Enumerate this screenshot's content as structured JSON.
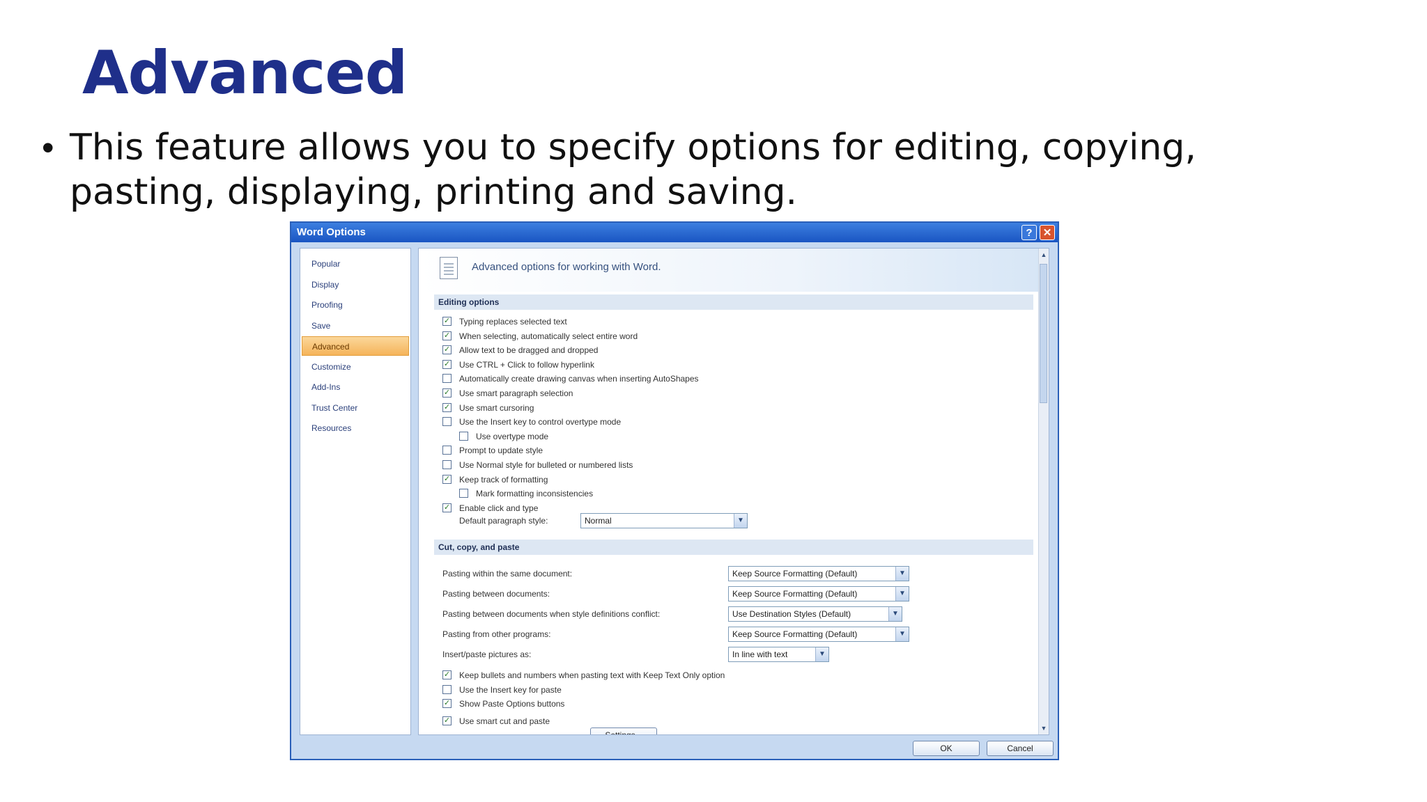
{
  "slide": {
    "title": "Advanced",
    "bullet": "This feature allows you to specify options for editing, copying, pasting, displaying, printing and saving."
  },
  "dialog": {
    "title": "Word Options",
    "help_glyph": "?",
    "close_glyph": "✕",
    "nav": [
      "Popular",
      "Display",
      "Proofing",
      "Save",
      "Advanced",
      "Customize",
      "Add-Ins",
      "Trust Center",
      "Resources"
    ],
    "selected_nav": "Advanced",
    "header_text": "Advanced options for working with Word.",
    "editing_section": "Editing options",
    "editing_options": [
      {
        "label": "Typing replaces selected text",
        "checked": true
      },
      {
        "label": "When selecting, automatically select entire word",
        "checked": true
      },
      {
        "label": "Allow text to be dragged and dropped",
        "checked": true
      },
      {
        "label": "Use CTRL + Click to follow hyperlink",
        "checked": true
      },
      {
        "label": "Automatically create drawing canvas when inserting AutoShapes",
        "checked": false
      },
      {
        "label": "Use smart paragraph selection",
        "checked": true
      },
      {
        "label": "Use smart cursoring",
        "checked": true
      },
      {
        "label": "Use the Insert key to control overtype mode",
        "checked": false
      },
      {
        "label": "Use overtype mode",
        "checked": false
      },
      {
        "label": "Prompt to update style",
        "checked": false
      },
      {
        "label": "Use Normal style for bulleted or numbered lists",
        "checked": false
      },
      {
        "label": "Keep track of formatting",
        "checked": true
      },
      {
        "label": "Mark formatting inconsistencies",
        "checked": false
      },
      {
        "label": "Enable click and type",
        "checked": true
      }
    ],
    "default_paragraph_label": "Default paragraph style:",
    "default_paragraph_value": "Normal",
    "cut_section": "Cut, copy, and paste",
    "paste_rows": [
      {
        "label": "Pasting within the same document:",
        "value": "Keep Source Formatting (Default)"
      },
      {
        "label": "Pasting between documents:",
        "value": "Keep Source Formatting (Default)"
      },
      {
        "label": "Pasting between documents when style definitions conflict:",
        "value": "Use Destination Styles (Default)"
      },
      {
        "label": "Pasting from other programs:",
        "value": "Keep Source Formatting (Default)"
      },
      {
        "label": "Insert/paste pictures as:",
        "value": "In line with text"
      }
    ],
    "paste_options": [
      {
        "label": "Keep bullets and numbers when pasting text with Keep Text Only option",
        "checked": true
      },
      {
        "label": "Use the Insert key for paste",
        "checked": false
      },
      {
        "label": "Show Paste Options buttons",
        "checked": true
      },
      {
        "label": "Use smart cut and paste",
        "checked": true
      }
    ],
    "settings_button": "Settings...",
    "ok_button": "OK",
    "cancel_button": "Cancel",
    "check_glyph": "✓",
    "arrow_glyph": "▼",
    "scroll_up_glyph": "▲",
    "scroll_down_glyph": "▼"
  }
}
